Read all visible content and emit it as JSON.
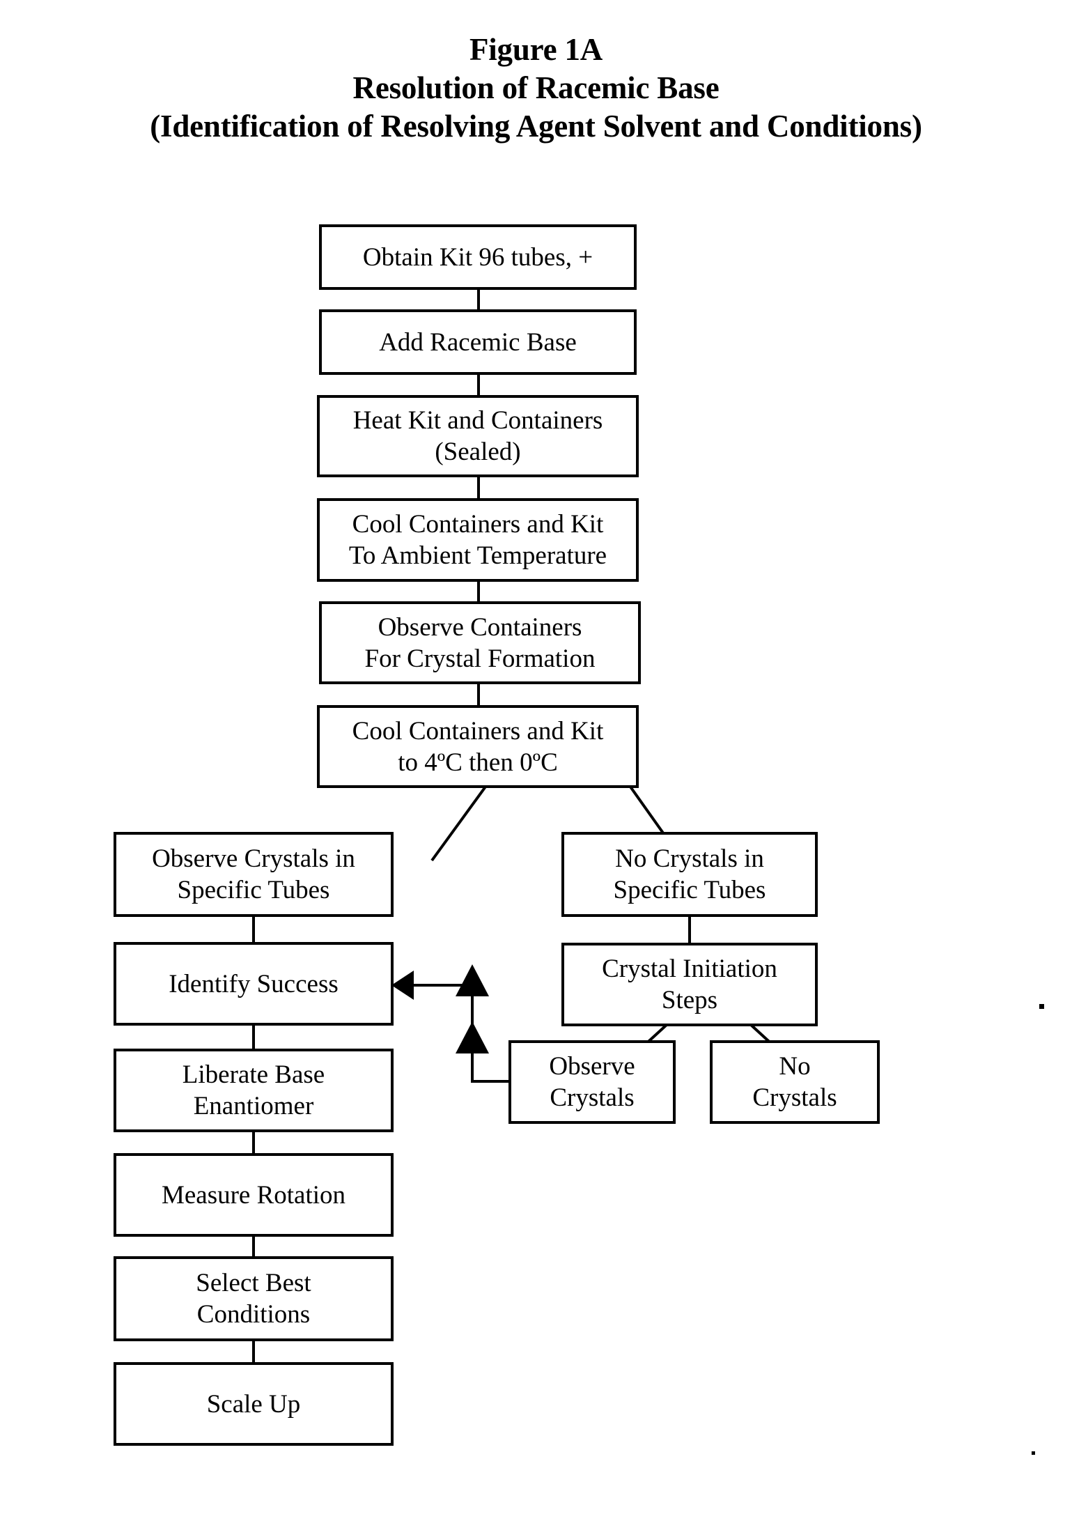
{
  "figure": {
    "title_lines": [
      "Figure 1A",
      "Resolution of Racemic Base",
      "(Identification of Resolving Agent Solvent and Conditions)"
    ]
  },
  "colors": {
    "ink": "#000000",
    "paper": "#ffffff"
  },
  "chart_data": {
    "type": "diagram",
    "diagram_kind": "flowchart",
    "title": "Figure 1A — Resolution of Racemic Base (Identification of Resolving Agent Solvent and Conditions)",
    "nodes": [
      {
        "id": "n1",
        "label": "Obtain Kit 96 tubes, +",
        "lines": [
          "Obtain Kit 96 tubes, +"
        ]
      },
      {
        "id": "n2",
        "label": "Add Racemic Base",
        "lines": [
          "Add Racemic Base"
        ]
      },
      {
        "id": "n3",
        "label": "Heat Kit and Containers (Sealed)",
        "lines": [
          "Heat Kit and Containers",
          "(Sealed)"
        ]
      },
      {
        "id": "n4",
        "label": "Cool Containers and Kit To Ambient Temperature",
        "lines": [
          "Cool Containers and Kit",
          "To Ambient Temperature"
        ]
      },
      {
        "id": "n5",
        "label": "Observe Containers For Crystal Formation",
        "lines": [
          "Observe Containers",
          "For Crystal Formation"
        ]
      },
      {
        "id": "n6",
        "label": "Cool Containers and Kit to 4oC then 0oC",
        "lines": [
          "Cool Containers and Kit",
          "to 4ºC then 0ºC"
        ]
      },
      {
        "id": "n7",
        "label": "Observe Crystals in Specific Tubes",
        "lines": [
          "Observe Crystals in",
          "Specific Tubes"
        ]
      },
      {
        "id": "n8",
        "label": "No Crystals in Specific Tubes",
        "lines": [
          "No Crystals in",
          "Specific Tubes"
        ]
      },
      {
        "id": "n9",
        "label": "Identify Success",
        "lines": [
          "Identify Success"
        ]
      },
      {
        "id": "n10",
        "label": "Crystal Initiation Steps",
        "lines": [
          "Crystal Initiation",
          "Steps"
        ]
      },
      {
        "id": "n11",
        "label": "Liberate Base Enantiomer",
        "lines": [
          "Liberate Base",
          "Enantiomer"
        ]
      },
      {
        "id": "n12",
        "label": "Observe Crystals",
        "lines": [
          "Observe",
          "Crystals"
        ]
      },
      {
        "id": "n13",
        "label": "No Crystals",
        "lines": [
          "No",
          "Crystals"
        ]
      },
      {
        "id": "n14",
        "label": "Measure Rotation",
        "lines": [
          "Measure Rotation"
        ]
      },
      {
        "id": "n15",
        "label": "Select Best Conditions",
        "lines": [
          "Select Best",
          "Conditions"
        ]
      },
      {
        "id": "n16",
        "label": "Scale Up",
        "lines": [
          "Scale Up"
        ]
      }
    ],
    "edges": [
      {
        "from": "n1",
        "to": "n2",
        "style": "plain"
      },
      {
        "from": "n2",
        "to": "n3",
        "style": "plain"
      },
      {
        "from": "n3",
        "to": "n4",
        "style": "plain"
      },
      {
        "from": "n4",
        "to": "n5",
        "style": "plain"
      },
      {
        "from": "n5",
        "to": "n6",
        "style": "plain"
      },
      {
        "from": "n6",
        "to": "n7",
        "style": "branch-left"
      },
      {
        "from": "n6",
        "to": "n8",
        "style": "branch-right"
      },
      {
        "from": "n7",
        "to": "n9",
        "style": "plain"
      },
      {
        "from": "n8",
        "to": "n10",
        "style": "plain"
      },
      {
        "from": "n9",
        "to": "n11",
        "style": "plain"
      },
      {
        "from": "n10",
        "to": "n12",
        "style": "branch-left"
      },
      {
        "from": "n10",
        "to": "n13",
        "style": "branch-right"
      },
      {
        "from": "n12",
        "to": "n9",
        "style": "arrow-feedback"
      },
      {
        "from": "n11",
        "to": "n14",
        "style": "plain"
      },
      {
        "from": "n14",
        "to": "n15",
        "style": "plain"
      },
      {
        "from": "n15",
        "to": "n16",
        "style": "plain"
      }
    ]
  }
}
